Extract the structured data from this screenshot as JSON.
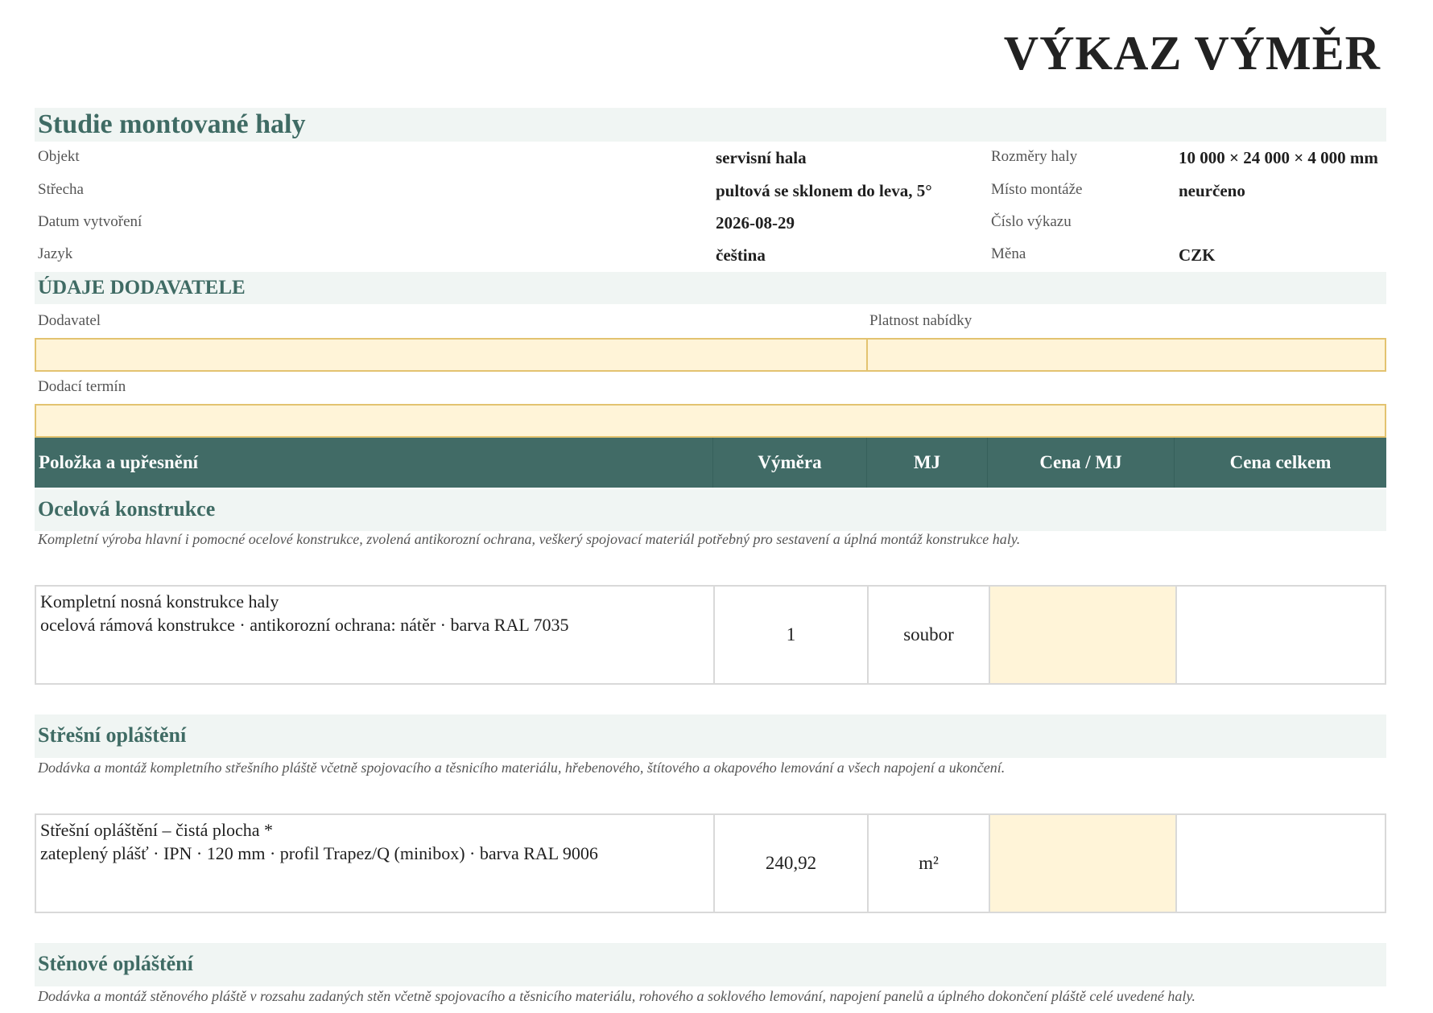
{
  "document": {
    "title": "VÝKAZ VÝMĚR"
  },
  "project": {
    "title": "Studie montované haly",
    "fields": {
      "objekt": {
        "label": "Objekt",
        "value": "servisní hala"
      },
      "strecha": {
        "label": "Střecha",
        "value": "pultová se sklonem do leva, 5°"
      },
      "datum": {
        "label": "Datum vytvoření",
        "value": "2026-08-29"
      },
      "jazyk": {
        "label": "Jazyk",
        "value": "čeština"
      },
      "rozmery": {
        "label": "Rozměry haly",
        "value": "10 000 × 24 000 × 4 000 mm"
      },
      "misto": {
        "label": "Místo montáže",
        "value": "neurčeno"
      },
      "cislo": {
        "label": "Číslo výkazu",
        "value": ""
      },
      "mena": {
        "label": "Měna",
        "value": "CZK"
      }
    }
  },
  "supplier": {
    "title": "ÚDAJE DODAVATELE",
    "dodavatel_label": "Dodavatel",
    "platnost_label": "Platnost nabídky",
    "termin_label": "Dodací termín",
    "dodavatel_value": "",
    "platnost_value": "",
    "termin_value": ""
  },
  "table": {
    "headers": {
      "item": "Položka a upřesnění",
      "qty": "Výměra",
      "unit": "MJ",
      "unit_price": "Cena / MJ",
      "total": "Cena celkem"
    }
  },
  "sections": [
    {
      "title": "Ocelová konstrukce",
      "description": "Kompletní výroba hlavní i pomocné ocelové konstrukce, zvolená antikorozní ochrana, veškerý spojovací materiál potřebný pro sestavení a úplná montáž konstrukce haly.",
      "items": [
        {
          "name": "Kompletní nosná konstrukce haly",
          "spec": "ocelová rámová konstrukce · antikorozní ochrana: nátěr · barva RAL 7035",
          "qty": "1",
          "unit": "soubor",
          "unit_price": "",
          "total": ""
        }
      ]
    },
    {
      "title": "Střešní opláštění",
      "description": "Dodávka a montáž kompletního střešního pláště včetně spojovacího a těsnicího materiálu, hřebenového, štítového a okapového lemování a všech napojení a ukončení.",
      "items": [
        {
          "name": "Střešní opláštění – čistá plocha *",
          "spec": "zateplený plášť · IPN · 120 mm · profil Trapez/Q (minibox) · barva RAL 9006",
          "qty": "240,92",
          "unit": "m²",
          "unit_price": "",
          "total": ""
        }
      ]
    },
    {
      "title": "Stěnové opláštění",
      "description": "Dodávka a montáž stěnového pláště v rozsahu zadaných stěn včetně spojovacího a těsnicího materiálu, rohového a soklového lemování, napojení panelů a úplného dokončení pláště celé uvedené haly.",
      "items": []
    }
  ]
}
